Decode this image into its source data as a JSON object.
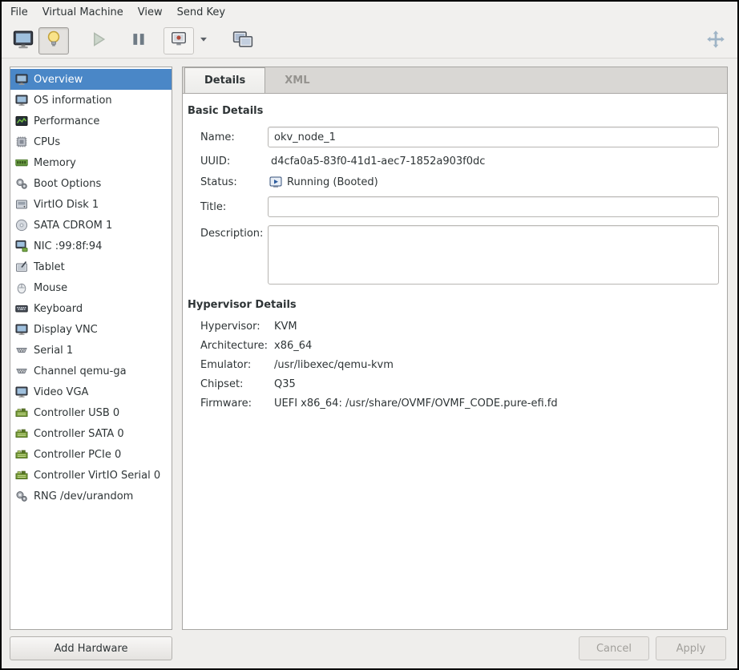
{
  "menubar": {
    "items": [
      "File",
      "Virtual Machine",
      "View",
      "Send Key"
    ]
  },
  "toolbar": {
    "buttons": [
      {
        "name": "console",
        "icon": "console-monitor-icon"
      },
      {
        "name": "hardware-details",
        "icon": "lightbulb-icon",
        "state": "active"
      },
      {
        "name": "run",
        "icon": "play-icon",
        "state": "disabled"
      },
      {
        "name": "pause",
        "icon": "pause-icon"
      },
      {
        "name": "shutdown",
        "icon": "shutdown-icon"
      },
      {
        "name": "shutdown-menu",
        "icon": "chevron-down-icon"
      },
      {
        "name": "snapshots",
        "icon": "snapshots-icon"
      },
      {
        "name": "fullscreen",
        "icon": "fullscreen-arrows-icon"
      }
    ]
  },
  "sidebar": {
    "items": [
      {
        "label": "Overview",
        "icon": "monitor-icon",
        "selected": true
      },
      {
        "label": "OS information",
        "icon": "monitor-icon",
        "selected": false
      },
      {
        "label": "Performance",
        "icon": "performance-graph-icon",
        "selected": false
      },
      {
        "label": "CPUs",
        "icon": "cpu-icon",
        "selected": false
      },
      {
        "label": "Memory",
        "icon": "memory-icon",
        "selected": false
      },
      {
        "label": "Boot Options",
        "icon": "gears-icon",
        "selected": false
      },
      {
        "label": "VirtIO Disk 1",
        "icon": "disk-icon",
        "selected": false
      },
      {
        "label": "SATA CDROM 1",
        "icon": "cdrom-icon",
        "selected": false
      },
      {
        "label": "NIC :99:8f:94",
        "icon": "nic-icon",
        "selected": false
      },
      {
        "label": "Tablet",
        "icon": "tablet-icon",
        "selected": false
      },
      {
        "label": "Mouse",
        "icon": "mouse-icon",
        "selected": false
      },
      {
        "label": "Keyboard",
        "icon": "keyboard-icon",
        "selected": false
      },
      {
        "label": "Display VNC",
        "icon": "monitor-icon",
        "selected": false
      },
      {
        "label": "Serial 1",
        "icon": "serial-port-icon",
        "selected": false
      },
      {
        "label": "Channel qemu-ga",
        "icon": "serial-port-icon",
        "selected": false
      },
      {
        "label": "Video VGA",
        "icon": "monitor-icon",
        "selected": false
      },
      {
        "label": "Controller USB 0",
        "icon": "controller-board-icon",
        "selected": false
      },
      {
        "label": "Controller SATA 0",
        "icon": "controller-board-icon",
        "selected": false
      },
      {
        "label": "Controller PCIe 0",
        "icon": "controller-board-icon",
        "selected": false
      },
      {
        "label": "Controller VirtIO Serial 0",
        "icon": "controller-board-icon",
        "selected": false
      },
      {
        "label": "RNG /dev/urandom",
        "icon": "gears-icon",
        "selected": false
      }
    ]
  },
  "tabs": [
    {
      "label": "Details",
      "active": true
    },
    {
      "label": "XML",
      "active": false
    }
  ],
  "details": {
    "basic": {
      "heading": "Basic Details",
      "name_label": "Name:",
      "name_value": "okv_node_1",
      "uuid_label": "UUID:",
      "uuid_value": "d4cfa0a5-83f0-41d1-aec7-1852a903f0dc",
      "status_label": "Status:",
      "status_value": "Running (Booted)",
      "status_icon": "vm-running-icon",
      "title_label": "Title:",
      "title_value": "",
      "description_label": "Description:",
      "description_value": ""
    },
    "hypervisor": {
      "heading": "Hypervisor Details",
      "rows": [
        {
          "label": "Hypervisor:",
          "value": "KVM"
        },
        {
          "label": "Architecture:",
          "value": "x86_64"
        },
        {
          "label": "Emulator:",
          "value": "/usr/libexec/qemu-kvm"
        },
        {
          "label": "Chipset:",
          "value": "Q35"
        },
        {
          "label": "Firmware:",
          "value": "UEFI x86_64: /usr/share/OVMF/OVMF_CODE.pure-efi.fd"
        }
      ]
    }
  },
  "footer": {
    "add_hardware": "Add Hardware",
    "cancel": "Cancel",
    "apply": "Apply"
  },
  "colors": {
    "selection_blue": "#4a87c7",
    "running_icon_blue": "#2d5c9e",
    "window_bg": "#efeeec"
  }
}
